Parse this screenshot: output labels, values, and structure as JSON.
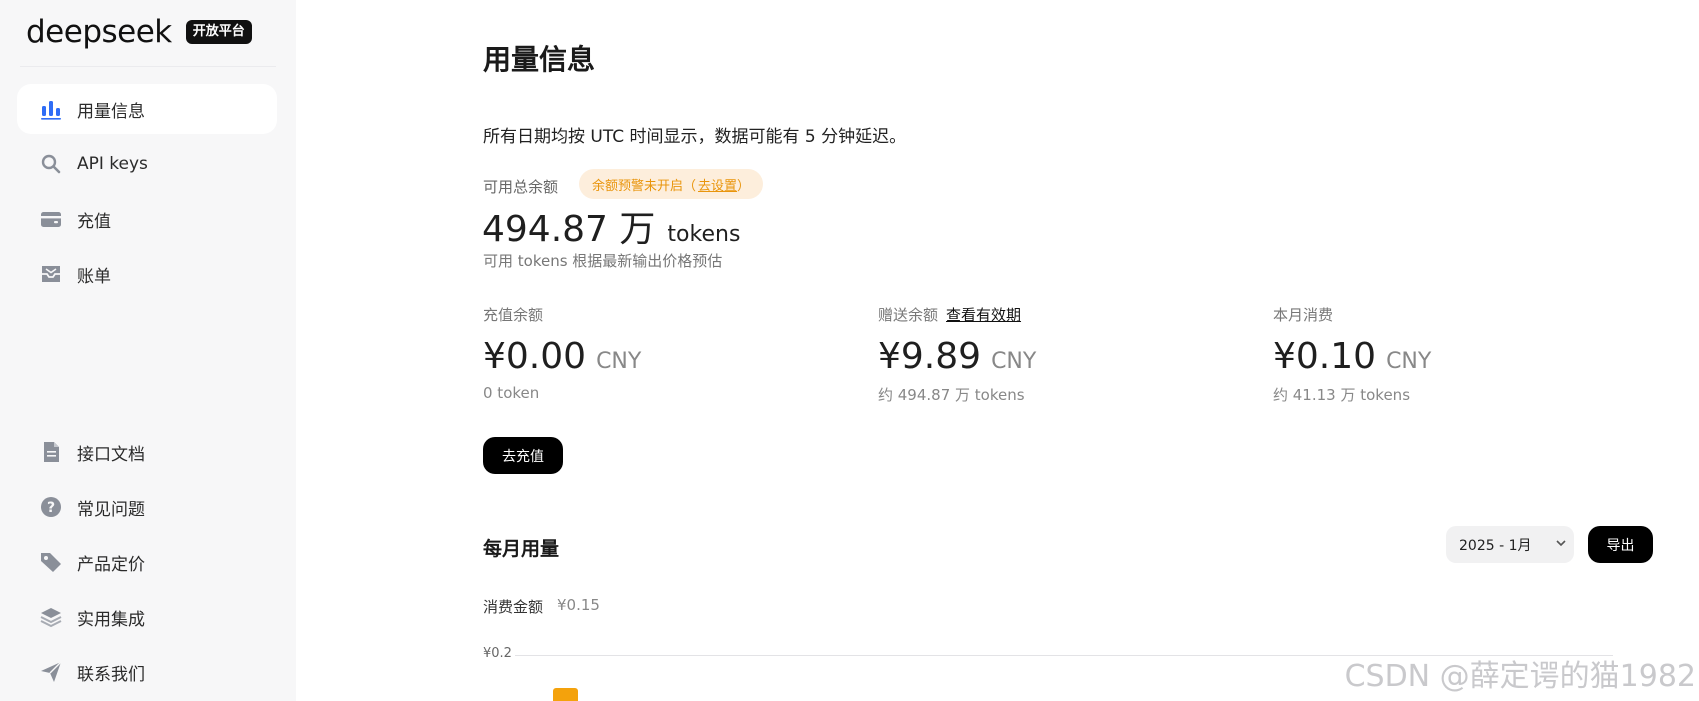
{
  "brand": {
    "name": "deepseek",
    "badge": "开放平台"
  },
  "sidebar": {
    "items": [
      {
        "label": "用量信息",
        "icon": "bar-chart-icon",
        "active": true
      },
      {
        "label": "API keys",
        "icon": "search-icon"
      },
      {
        "label": "充值",
        "icon": "wallet-icon"
      },
      {
        "label": "账单",
        "icon": "inbox-icon"
      },
      {
        "label": "接口文档",
        "icon": "document-icon"
      },
      {
        "label": "常见问题",
        "icon": "question-icon"
      },
      {
        "label": "产品定价",
        "icon": "tag-icon"
      },
      {
        "label": "实用集成",
        "icon": "layers-icon"
      },
      {
        "label": "联系我们",
        "icon": "send-icon"
      }
    ]
  },
  "page": {
    "title": "用量信息",
    "notice": "所有日期均按 UTC 时间显示，数据可能有 5 分钟延迟。"
  },
  "balance": {
    "label": "可用总余额",
    "alert_text": "余额预警未开启（",
    "alert_link": "去设置",
    "alert_close": "）",
    "amount": "494.87 万",
    "unit": "tokens",
    "note": "可用 tokens 根据最新输出价格预估"
  },
  "stats": {
    "recharge": {
      "label": "充值余额",
      "amount": "¥0.00",
      "currency": "CNY",
      "sub": "0 token"
    },
    "gift": {
      "label": "赠送余额",
      "link": "查看有效期",
      "amount": "¥9.89",
      "currency": "CNY",
      "sub": "约 494.87 万 tokens"
    },
    "monthly": {
      "label": "本月消费",
      "amount": "¥0.10",
      "currency": "CNY",
      "sub": "约 41.13 万 tokens"
    }
  },
  "actions": {
    "recharge_button": "去充值",
    "export_button": "导出"
  },
  "monthly_usage": {
    "title": "每月用量",
    "selected_month": "2025 - 1月",
    "cost_label": "消费金额",
    "cost_value": "¥0.15",
    "y_tick": "¥0.2"
  },
  "watermark": "CSDN @薛定谔的猫1982",
  "colors": {
    "accent": "#f4a20c",
    "alert_bg": "#fdeedc",
    "alert_text": "#e9950c",
    "active_icon": "#2f6df6"
  }
}
